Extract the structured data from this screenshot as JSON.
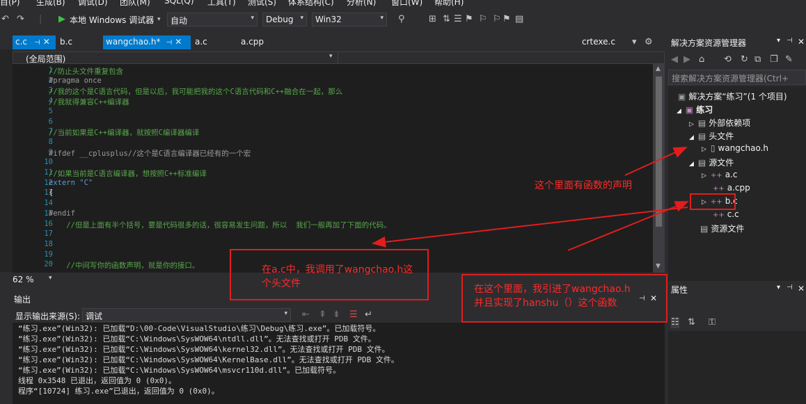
{
  "menu": [
    "目(P)",
    "生成(B)",
    "调试(D)",
    "团队(M)",
    "SQL(Q)",
    "工具(T)",
    "测试(S)",
    "体系结构(C)",
    "分析(N)",
    "窗口(W)",
    "帮助(H)"
  ],
  "toolbar": {
    "debugger_label": "本地 Windows 调试器",
    "mode": "自动",
    "config": "Debug",
    "platform": "Win32"
  },
  "tabs": [
    "c.c",
    "b.c",
    "wangchao.h*",
    "a.c",
    "a.cpp",
    "crtexe.c"
  ],
  "nav_scope": "(全局范围)",
  "code": [
    {
      "n": "1",
      "t": "//防止头文件重复包含",
      "c": "cm"
    },
    {
      "n": "2",
      "t": "#pragma once",
      "c": "pp"
    },
    {
      "n": "3",
      "t": "//我的这个是C语言代码，但是以后，我可能把我的这个C语言代码和C++融合在一起，那么",
      "c": "cm"
    },
    {
      "n": "4",
      "t": "//我就得兼容C++编译器",
      "c": "cm"
    },
    {
      "n": "5",
      "t": "",
      "c": "tx"
    },
    {
      "n": "6",
      "t": "",
      "c": "tx"
    },
    {
      "n": "7",
      "t": "//当前如果是C++编译器，就按照C编译器编译",
      "c": "cm"
    },
    {
      "n": "8",
      "t": "",
      "c": "tx"
    },
    {
      "n": "9",
      "t": "#ifdef __cplusplus//这个是C语言编译器已经有的一个宏",
      "c": "pp"
    },
    {
      "n": "10",
      "t": "",
      "c": "tx"
    },
    {
      "n": "11",
      "t": "//如果当前是C语言编译器，想按照C++标准编译",
      "c": "cm"
    },
    {
      "n": "12",
      "t": "extern \"C\"",
      "c": "kw"
    },
    {
      "n": "13",
      "t": "{",
      "c": "tx"
    },
    {
      "n": "14",
      "t": "",
      "c": "tx"
    },
    {
      "n": "15",
      "t": "#endif",
      "c": "pp"
    },
    {
      "n": "16",
      "t": "    //但是上面有半个括号，要是代码很多的话，很容易发生问题，所以  我们一般再加了下面的代码。",
      "c": "cm"
    },
    {
      "n": "17",
      "t": "",
      "c": "tx"
    },
    {
      "n": "18",
      "t": "",
      "c": "tx"
    },
    {
      "n": "19",
      "t": "",
      "c": "tx"
    },
    {
      "n": "20",
      "t": "    //中间写你的函数声明，就是你的接口。",
      "c": "cm"
    }
  ],
  "zoom": "62 %",
  "output": {
    "title": "输出",
    "source_label": "显示输出来源(S):",
    "source_value": "调试",
    "lines": [
      "“练习.exe”(Win32): 已加载“D:\\00-Code\\VisualStudio\\练习\\Debug\\练习.exe”。已加载符号。",
      "“练习.exe”(Win32): 已加载“C:\\Windows\\SysWOW64\\ntdll.dll”。无法查找或打开 PDB 文件。",
      "“练习.exe”(Win32): 已加载“C:\\Windows\\SysWOW64\\kernel32.dll”。无法查找或打开 PDB 文件。",
      "“练习.exe”(Win32): 已加载“C:\\Windows\\SysWOW64\\KernelBase.dll”。无法查找或打开 PDB 文件。",
      "“练习.exe”(Win32): 已加载“C:\\Windows\\SysWOW64\\msvcr110d.dll”。已加载符号。",
      "线程 0x3548 已退出，返回值为 0 (0x0)。",
      "程序“[10724] 练习.exe”已退出，返回值为 0 (0x0)。"
    ]
  },
  "solution_explorer": {
    "title": "解决方案资源管理器",
    "search_placeholder": "搜索解决方案资源管理器(Ctrl+",
    "items": [
      "解决方案“练习”(1 个项目)",
      "练习",
      "外部依赖项",
      "头文件",
      "wangchao.h",
      "源文件",
      "a.c",
      "a.cpp",
      "b.c",
      "c.c",
      "资源文件"
    ]
  },
  "properties": {
    "title": "属性"
  },
  "annotations": {
    "decl": "这个里面有函数的声明",
    "ac": "在a.c中，我调用了wangchao.h这\n个头文件",
    "bc": "在这个里面，我引进了wangchao.h\n并且实现了hanshu（）这个函数"
  },
  "colors": {
    "accent": "#007acc",
    "annotation": "#ff2a2a",
    "comment": "#57a64a",
    "keyword": "#569cd6"
  }
}
